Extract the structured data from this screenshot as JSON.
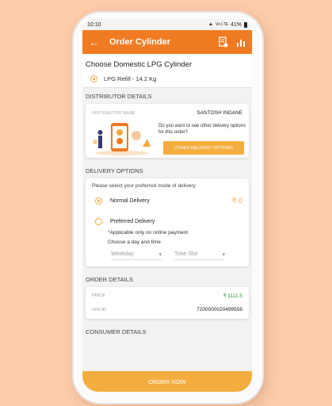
{
  "status_bar": {
    "time": "10:10",
    "signal": "Vo LTE",
    "battery": "41%"
  },
  "app_bar": {
    "back_icon": "arrow-left-icon",
    "title": "Order Cylinder",
    "icon1": "receipt-icon",
    "icon2": "bar-chart-icon"
  },
  "lpg": {
    "title": "Choose Domestic LPG Cylinder",
    "option": "LPG Refill - 14.2 Kg"
  },
  "distributor": {
    "section": "DISTRIBUTOR DETAILS",
    "label": "DISTRIBUTOR NAME",
    "name": "SANTOSH INDANE",
    "question": "Do you want to see other delivery options for this order?",
    "button": "OTHER DELIVERY OPTIONS"
  },
  "delivery": {
    "section": "DELIVERY OPTIONS",
    "hint": "Please select your preferred mode of delivery",
    "normal_label": "Normal Delivery",
    "normal_price": "₹ 0",
    "preferred_label": "Preferred Delivery",
    "preferred_note": "*Applicable only on online payment",
    "choose": "Choose a day and time",
    "weekday": "Weekday",
    "timeslot": "Time Slot"
  },
  "order_details": {
    "section": "ORDER DETAILS",
    "price_label": "PRICE",
    "price": "₹ 1111.5",
    "lpg_id_label": "LPG ID",
    "lpg_id": "7200000020499558"
  },
  "consumer": {
    "section": "CONSUMER DETAILS"
  },
  "order_button": "ORDER NOW",
  "colors": {
    "primary": "#f07b22",
    "accent": "#f4ad3f",
    "green": "#2e9a3a",
    "background": "#fdccab"
  }
}
